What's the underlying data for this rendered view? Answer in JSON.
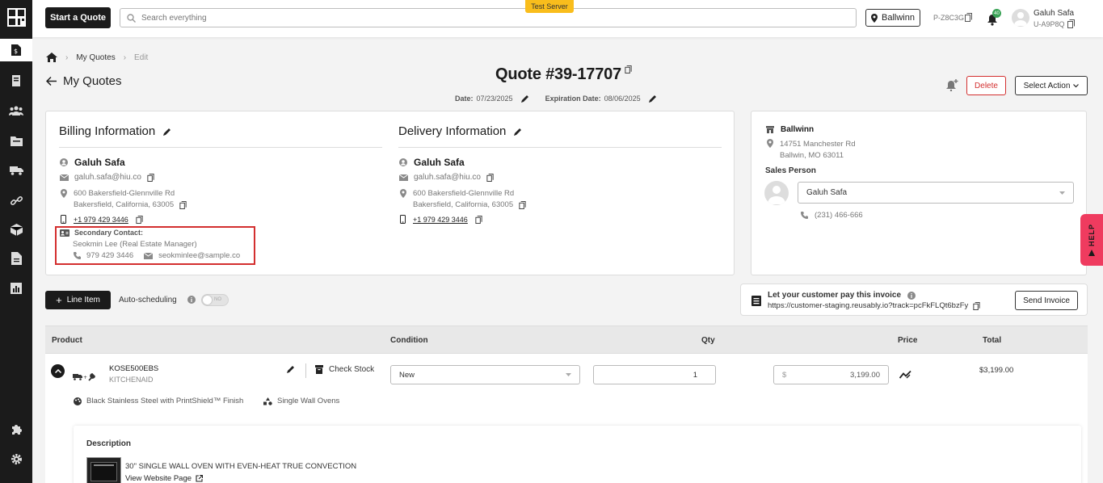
{
  "topbar": {
    "start_quote_label": "Start a Quote",
    "search_placeholder": "Search everything",
    "test_server_label": "Test Server",
    "location_label": "Ballwinn",
    "store_code": "P-Z8C3G",
    "notifications_count": "40",
    "user_name": "Galuh Safa",
    "user_code": "U-A9P8Q"
  },
  "breadcrumb": {
    "item1": "My Quotes",
    "item2": "Edit"
  },
  "page": {
    "back_label": "My Quotes",
    "quote_title": "Quote #39-17707",
    "date_label": "Date:",
    "date_value": "07/23/2025",
    "expiration_label": "Expiration Date:",
    "expiration_value": "08/06/2025",
    "delete_label": "Delete",
    "select_action_label": "Select Action"
  },
  "billing": {
    "heading": "Billing Information",
    "name": "Galuh Safa",
    "email": "galuh.safa@hiu.co",
    "address_line1": "600 Bakersfield-Glennville Rd",
    "address_line2": "Bakersfield, California, 63005",
    "phone": "+1 979 429 3446",
    "secondary_heading": "Secondary Contact:",
    "secondary_name": "Seokmin Lee (Real Estate Manager)",
    "secondary_phone": "979 429 3446",
    "secondary_email": "seokminlee@sample.co"
  },
  "delivery": {
    "heading": "Delivery Information",
    "name": "Galuh Safa",
    "email": "galuh.safa@hiu.co",
    "address_line1": "600 Bakersfield-Glennville Rd",
    "address_line2": "Bakersfield, California, 63005",
    "phone": "+1 979 429 3446"
  },
  "store": {
    "name": "Ballwinn",
    "address_line1": "14751 Manchester Rd",
    "address_line2": "Ballwin, MO 63011",
    "sales_person_label": "Sales Person",
    "sales_person_value": "Galuh Safa",
    "phone": "(231) 466-666"
  },
  "actions": {
    "line_item_label": "Line Item",
    "auto_scheduling_label": "Auto-scheduling",
    "toggle_label": "NO"
  },
  "invoice": {
    "title": "Let your customer pay this invoice",
    "url": "https://customer-staging.reusably.io?track=pcFkFLQt6bzFy",
    "send_label": "Send Invoice"
  },
  "table": {
    "headers": [
      "Product",
      "Condition",
      "Qty",
      "Price",
      "Total"
    ]
  },
  "line_item": {
    "sku": "KOSE500EBS",
    "brand": "KITCHENAID",
    "check_stock_label": "Check Stock",
    "condition": "New",
    "qty": "1",
    "currency_symbol": "$",
    "price": "3,199.00",
    "total": "$3,199.00",
    "finish": "Black Stainless Steel with PrintShield™ Finish",
    "category": "Single Wall Ovens",
    "description_label": "Description",
    "description_text": "30\" SINGLE WALL OVEN WITH EVEN-HEAT TRUE CONVECTION",
    "website_link": "View Website Page"
  },
  "help_label": "HELP",
  "colors": {
    "accent_red": "#d32f2f",
    "test_server": "#f9bd1c",
    "help_pink": "#ef3b5f"
  }
}
